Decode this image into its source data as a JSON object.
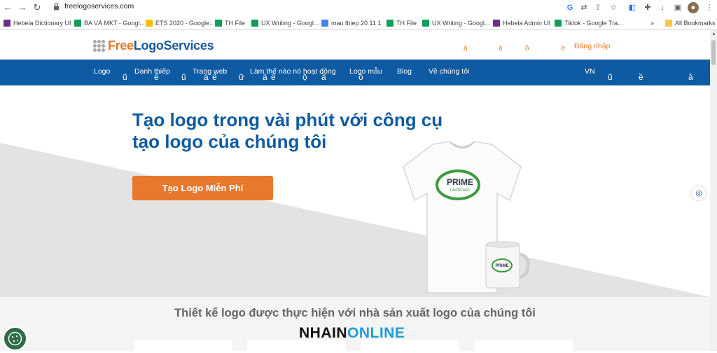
{
  "browser": {
    "url": "freelogoservices.com",
    "nav_icons": [
      "back-icon",
      "forward-icon",
      "reload-icon"
    ],
    "toolbar_icons": [
      "google-icon",
      "translate-icon",
      "share-icon",
      "star-icon",
      "translate-app-icon",
      "extensions-icon",
      "download-icon",
      "split-icon",
      "profile-icon",
      "menu-icon"
    ]
  },
  "bookmarks": {
    "items": [
      {
        "label": "Hebela Dictionary UI",
        "color": "#6b2f8a"
      },
      {
        "label": "BA VÀ MKT - Googl...",
        "color": "#0f9d58"
      },
      {
        "label": "ETS 2020 - Google...",
        "color": "#fbbc04"
      },
      {
        "label": "TH File",
        "color": "#0f9d58"
      },
      {
        "label": "UX Writing - Googl...",
        "color": "#0f9d58"
      },
      {
        "label": "mau thiep 20 11 1",
        "color": "#4285f4"
      },
      {
        "label": "TH File",
        "color": "#0f9d58"
      },
      {
        "label": "UX Writing - Googl...",
        "color": "#0f9d58"
      },
      {
        "label": "Hebela Admin UI",
        "color": "#6b2f8a"
      },
      {
        "label": "Tiktok - Google Tra...",
        "color": "#0f9d58"
      }
    ],
    "overflow": "»",
    "all_label": "All Bookmarks"
  },
  "site": {
    "logo_free": "Free",
    "logo_rest": "LogoServices",
    "header_glyphs": [
      "ả",
      "ả",
      "ồ",
      "ờ"
    ],
    "login": "Đăng nhập",
    "nav": [
      "Logo",
      "Danh thiếp",
      "Trang web",
      "Làm thế nào nó hoạt động",
      "Logo mẫu",
      "Blog",
      "Về chúng tôi"
    ],
    "lang": "VN",
    "nav_glyphs": [
      "ũ",
      "ế",
      "ũ",
      "ầ",
      "ế",
      "ữ",
      "ầ",
      "ế",
      "ộ",
      "ầ",
      "ồ",
      "ũ",
      "ề",
      "ả"
    ],
    "hero_title": "Tạo logo trong vài phút với công cụ tạo logo của chúng tôi",
    "cta": "Tạo Logo Miễn Phí",
    "shirt_brand": "PRIME",
    "shirt_sub": "LAWNCARE",
    "section_title": "Thiết kế logo được thực hiện với nhà sản xuất logo của chúng tôi",
    "watermark_a": "NHAIN",
    "watermark_b": "ONLINE",
    "brand_blue": "#0f5ba3",
    "brand_orange": "#e8782d"
  }
}
